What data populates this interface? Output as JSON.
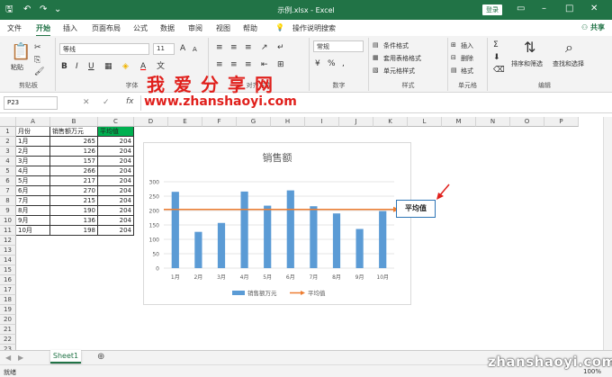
{
  "window": {
    "title": "示例.xlsx - Excel",
    "login": "登录"
  },
  "tabs": [
    "文件",
    "开始",
    "插入",
    "页面布局",
    "公式",
    "数据",
    "审阅",
    "视图",
    "帮助"
  ],
  "tell_me": "操作说明搜索",
  "share": "共享",
  "ribbon": {
    "clipboard": {
      "label": "剪贴板",
      "paste": "粘贴"
    },
    "font": {
      "label": "字体",
      "name": "等线",
      "size": "11"
    },
    "alignment": {
      "label": "对齐方式"
    },
    "number": {
      "label": "数字",
      "format": "常规"
    },
    "styles": {
      "label": "样式",
      "items": [
        "条件格式",
        "套用表格格式",
        "单元格样式"
      ]
    },
    "cells": {
      "label": "单元格",
      "items": [
        "插入",
        "删除",
        "格式"
      ]
    },
    "editing": {
      "label": "编辑",
      "sum_label": "Σ",
      "sort": "排序和筛选",
      "find": "查找和选择"
    }
  },
  "formula_bar": {
    "namebox": "P23",
    "fx": "fx",
    "value": ""
  },
  "columns": [
    "A",
    "B",
    "C",
    "D",
    "E",
    "F",
    "G",
    "H",
    "I",
    "J",
    "K",
    "L",
    "M",
    "N",
    "O",
    "P"
  ],
  "rows": [
    "1",
    "2",
    "3",
    "4",
    "5",
    "6",
    "7",
    "8",
    "9",
    "10",
    "11",
    "12",
    "13",
    "14",
    "15",
    "16",
    "17",
    "18",
    "19",
    "20",
    "21",
    "22",
    "23"
  ],
  "table": {
    "headers": [
      "月份",
      "销售额万元",
      "平均值"
    ],
    "data": [
      [
        "1月",
        "265",
        "204"
      ],
      [
        "2月",
        "126",
        "204"
      ],
      [
        "3月",
        "157",
        "204"
      ],
      [
        "4月",
        "266",
        "204"
      ],
      [
        "5月",
        "217",
        "204"
      ],
      [
        "6月",
        "270",
        "204"
      ],
      [
        "7月",
        "215",
        "204"
      ],
      [
        "8月",
        "190",
        "204"
      ],
      [
        "9月",
        "136",
        "204"
      ],
      [
        "10月",
        "198",
        "204"
      ]
    ]
  },
  "chart_data": {
    "type": "bar",
    "title": "销售额",
    "categories": [
      "1月",
      "2月",
      "3月",
      "4月",
      "5月",
      "6月",
      "7月",
      "8月",
      "9月",
      "10月"
    ],
    "series": [
      {
        "name": "销售额万元",
        "type": "bar",
        "values": [
          265,
          126,
          157,
          266,
          217,
          270,
          215,
          190,
          136,
          198
        ],
        "color": "#5b9bd5"
      },
      {
        "name": "平均值",
        "type": "line",
        "values": [
          204,
          204,
          204,
          204,
          204,
          204,
          204,
          204,
          204,
          204
        ],
        "color": "#ed7d31"
      }
    ],
    "yticks": [
      "0",
      "50",
      "100",
      "150",
      "200",
      "250",
      "300"
    ],
    "ylim": [
      0,
      300
    ],
    "legend": "bottom",
    "annotation": "平均值"
  },
  "watermark": {
    "title": "我爱分享网",
    "url": "www.zhanshaoyi.com",
    "corner": "zhanshaoyi.com"
  },
  "sheet": {
    "name": "Sheet1"
  },
  "status": {
    "left": "就绪",
    "zoom": "100%"
  }
}
